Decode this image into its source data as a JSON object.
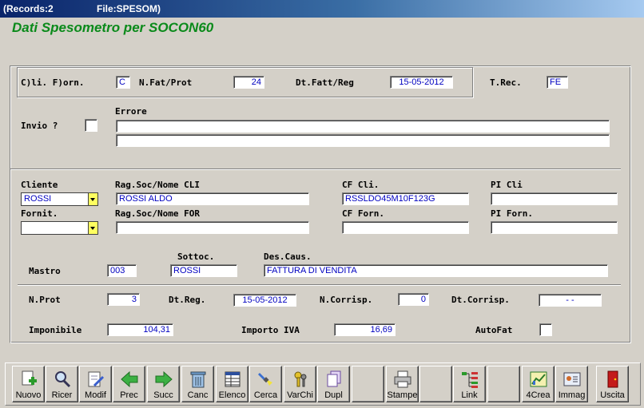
{
  "window": {
    "records": "(Records:2",
    "file": "File:SPESOM)"
  },
  "app_title": "Dati Spesometro per SOCON60",
  "form": {
    "cli_forn": {
      "label": "C)li. F)orn.",
      "value": "C"
    },
    "nfat": {
      "label": "N.Fat/Prot",
      "value": "24"
    },
    "dtfatt": {
      "label": "Dt.Fatt/Reg",
      "value": "15-05-2012"
    },
    "trec": {
      "label": "T.Rec.",
      "value": "FE"
    },
    "invio": {
      "label": "Invio ?"
    },
    "errore": {
      "label": "Errore",
      "line1": "",
      "line2": ""
    },
    "cliente": {
      "label": "Cliente",
      "value": "ROSSI"
    },
    "ragsoc_cli": {
      "label": "Rag.Soc/Nome CLI",
      "value": "ROSSI ALDO"
    },
    "cf_cli": {
      "label": "CF Cli.",
      "value": "RSSLDO45M10F123G"
    },
    "pi_cli": {
      "label": "PI Cli",
      "value": ""
    },
    "fornit": {
      "label": "Fornit.",
      "value": ""
    },
    "ragsoc_for": {
      "label": "Rag.Soc/Nome FOR",
      "value": ""
    },
    "cf_forn": {
      "label": "CF Forn.",
      "value": ""
    },
    "pi_forn": {
      "label": "PI Forn.",
      "value": ""
    },
    "mastro": {
      "label": "Mastro",
      "value": "003"
    },
    "sottoc": {
      "label": "Sottoc.",
      "value": "ROSSI"
    },
    "descaus": {
      "label": "Des.Caus.",
      "value": "FATTURA DI VENDITA"
    },
    "nprot": {
      "label": "N.Prot",
      "value": "3"
    },
    "dtreg": {
      "label": "Dt.Reg.",
      "value": "15-05-2012"
    },
    "ncorrisp": {
      "label": "N.Corrisp.",
      "value": "0"
    },
    "dtcorrisp": {
      "label": "Dt.Corrisp.",
      "value": "-  -"
    },
    "imponibile": {
      "label": "Imponibile",
      "value": "104,31"
    },
    "iva": {
      "label": "Importo IVA",
      "value": "16,69"
    },
    "autofat": {
      "label": "AutoFat"
    }
  },
  "toolbar": {
    "nuovo": "Nuovo",
    "ricer": "Ricer",
    "modif": "Modif",
    "prec": "Prec",
    "succ": "Succ",
    "canc": "Canc",
    "elenco": "Elenco",
    "cerca": "Cerca",
    "varchi": "VarChi",
    "dupl": "Dupl",
    "stampe": "Stampe",
    "link": "Link",
    "crea": "4Crea",
    "immag": "Immag",
    "uscita": "Uscita"
  }
}
